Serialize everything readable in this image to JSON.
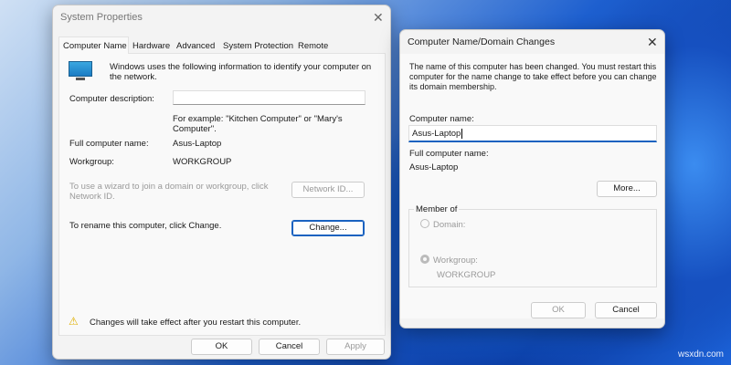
{
  "system_properties": {
    "title": "System Properties",
    "tabs": [
      "Computer Name",
      "Hardware",
      "Advanced",
      "System Protection",
      "Remote"
    ],
    "intro": "Windows uses the following information to identify your computer on the network.",
    "description_label": "Computer description:",
    "description_value": "",
    "example": "For example: \"Kitchen Computer\" or \"Mary's Computer\".",
    "full_name_label": "Full computer name:",
    "full_name_value": "Asus-Laptop",
    "workgroup_label": "Workgroup:",
    "workgroup_value": "WORKGROUP",
    "wizard_text": "To use a wizard to join a domain or workgroup, click Network ID.",
    "network_id_button": "Network ID...",
    "rename_text": "To rename this computer, click Change.",
    "change_button": "Change...",
    "warning": "Changes will take effect after you restart this computer.",
    "ok": "OK",
    "cancel": "Cancel",
    "apply": "Apply"
  },
  "domain_changes": {
    "title": "Computer Name/Domain Changes",
    "message": "The name of this computer has been changed.  You must restart this computer for the name change to take effect before you can change its domain membership.",
    "computer_name_label": "Computer name:",
    "computer_name_value": "Asus-Laptop",
    "full_name_label": "Full computer name:",
    "full_name_value": "Asus-Laptop",
    "more_button": "More...",
    "member_of": "Member of",
    "domain_label": "Domain:",
    "workgroup_label": "Workgroup:",
    "workgroup_value": "WORKGROUP",
    "ok": "OK",
    "cancel": "Cancel"
  },
  "watermark": "wsxdn.com"
}
